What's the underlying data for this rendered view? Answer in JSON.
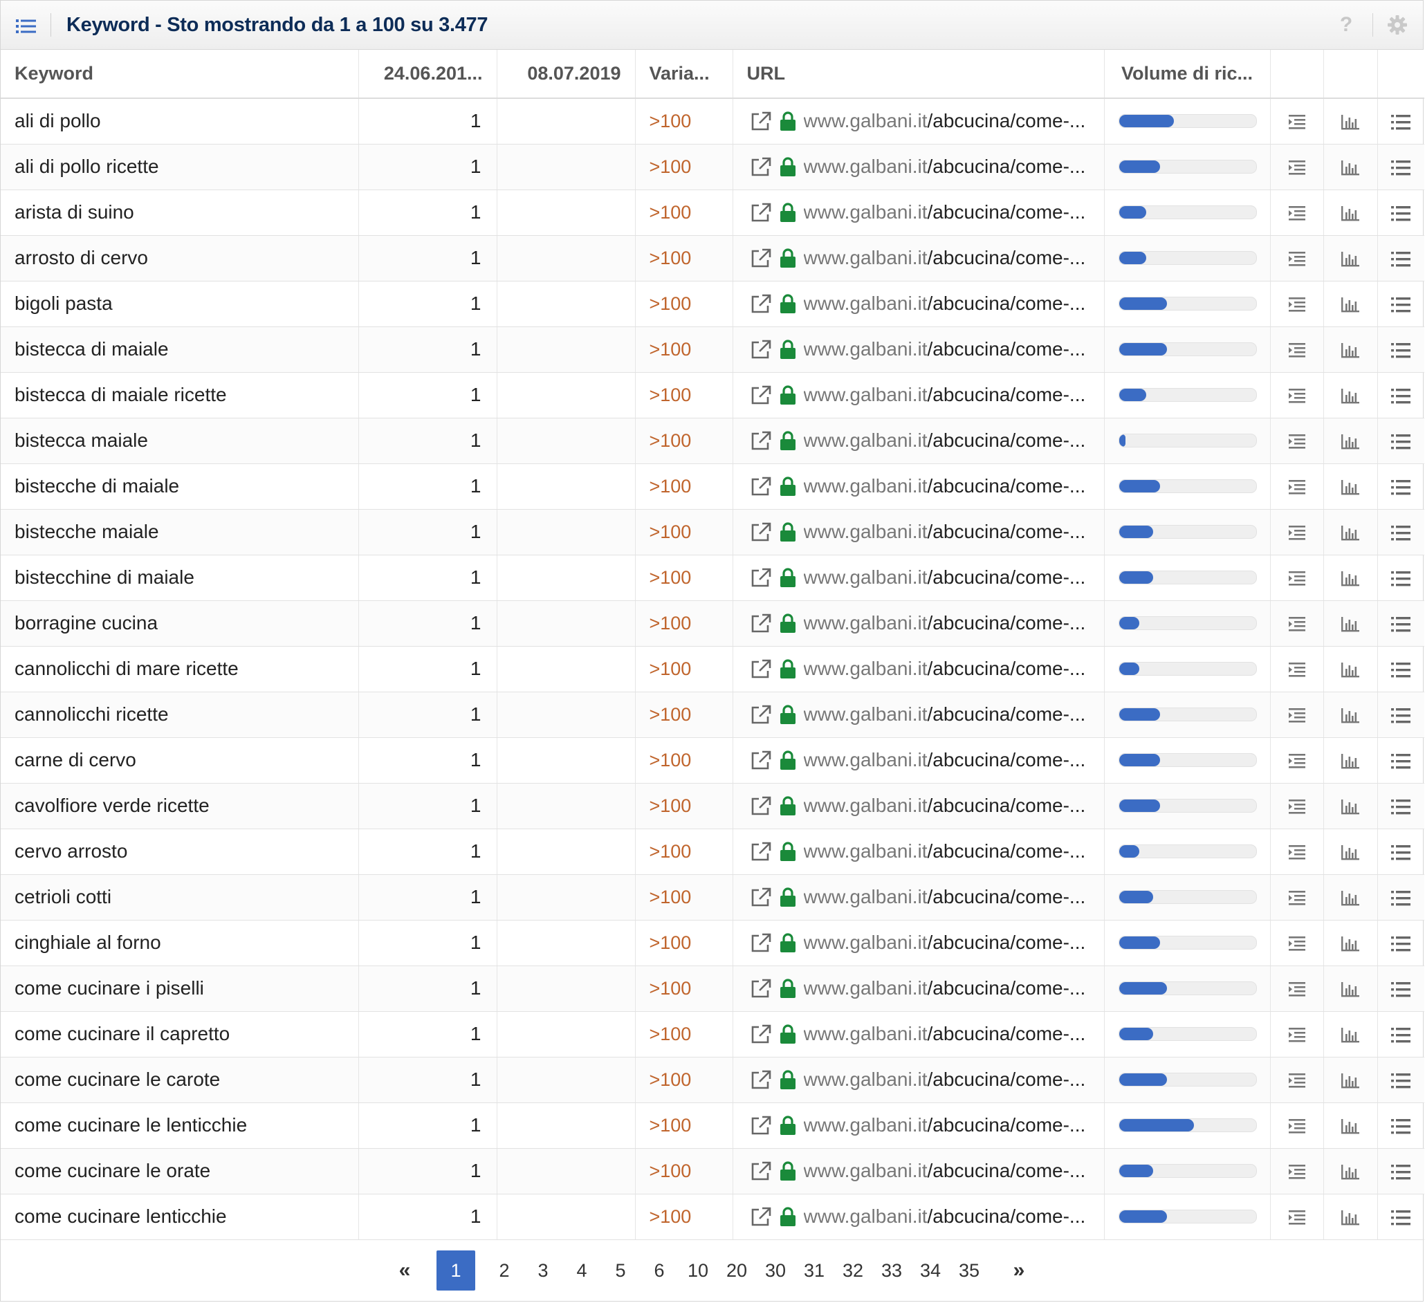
{
  "header": {
    "title": "Keyword - Sto mostrando da 1 a 100 su 3.477",
    "help_label": "?"
  },
  "columns": {
    "keyword": "Keyword",
    "date1": "24.06.201...",
    "date2": "08.07.2019",
    "variation": "Varia...",
    "url": "URL",
    "volume": "Volume di ric..."
  },
  "colors": {
    "accent": "#3b6cc4",
    "title": "#0d2c57",
    "variation": "#c0652d",
    "lock": "#1a8a3a"
  },
  "rows": [
    {
      "keyword": "ali di pollo",
      "pos1": "1",
      "pos2": "",
      "variation": ">100",
      "url_domain": "www.galbani.it",
      "url_path": "/abcucina/come-...",
      "volume": 0.4
    },
    {
      "keyword": "ali di pollo ricette",
      "pos1": "1",
      "pos2": "",
      "variation": ">100",
      "url_domain": "www.galbani.it",
      "url_path": "/abcucina/come-...",
      "volume": 0.3
    },
    {
      "keyword": "arista di suino",
      "pos1": "1",
      "pos2": "",
      "variation": ">100",
      "url_domain": "www.galbani.it",
      "url_path": "/abcucina/come-...",
      "volume": 0.2
    },
    {
      "keyword": "arrosto di cervo",
      "pos1": "1",
      "pos2": "",
      "variation": ">100",
      "url_domain": "www.galbani.it",
      "url_path": "/abcucina/come-...",
      "volume": 0.2
    },
    {
      "keyword": "bigoli pasta",
      "pos1": "1",
      "pos2": "",
      "variation": ">100",
      "url_domain": "www.galbani.it",
      "url_path": "/abcucina/come-...",
      "volume": 0.35
    },
    {
      "keyword": "bistecca di maiale",
      "pos1": "1",
      "pos2": "",
      "variation": ">100",
      "url_domain": "www.galbani.it",
      "url_path": "/abcucina/come-...",
      "volume": 0.35
    },
    {
      "keyword": "bistecca di maiale ricette",
      "pos1": "1",
      "pos2": "",
      "variation": ">100",
      "url_domain": "www.galbani.it",
      "url_path": "/abcucina/come-...",
      "volume": 0.2
    },
    {
      "keyword": "bistecca maiale",
      "pos1": "1",
      "pos2": "",
      "variation": ">100",
      "url_domain": "www.galbani.it",
      "url_path": "/abcucina/come-...",
      "volume": 0.05
    },
    {
      "keyword": "bistecche di maiale",
      "pos1": "1",
      "pos2": "",
      "variation": ">100",
      "url_domain": "www.galbani.it",
      "url_path": "/abcucina/come-...",
      "volume": 0.3
    },
    {
      "keyword": "bistecche maiale",
      "pos1": "1",
      "pos2": "",
      "variation": ">100",
      "url_domain": "www.galbani.it",
      "url_path": "/abcucina/come-...",
      "volume": 0.25
    },
    {
      "keyword": "bistecchine di maiale",
      "pos1": "1",
      "pos2": "",
      "variation": ">100",
      "url_domain": "www.galbani.it",
      "url_path": "/abcucina/come-...",
      "volume": 0.25
    },
    {
      "keyword": "borragine cucina",
      "pos1": "1",
      "pos2": "",
      "variation": ">100",
      "url_domain": "www.galbani.it",
      "url_path": "/abcucina/come-...",
      "volume": 0.15
    },
    {
      "keyword": "cannolicchi di mare ricette",
      "pos1": "1",
      "pos2": "",
      "variation": ">100",
      "url_domain": "www.galbani.it",
      "url_path": "/abcucina/come-...",
      "volume": 0.15
    },
    {
      "keyword": "cannolicchi ricette",
      "pos1": "1",
      "pos2": "",
      "variation": ">100",
      "url_domain": "www.galbani.it",
      "url_path": "/abcucina/come-...",
      "volume": 0.3
    },
    {
      "keyword": "carne di cervo",
      "pos1": "1",
      "pos2": "",
      "variation": ">100",
      "url_domain": "www.galbani.it",
      "url_path": "/abcucina/come-...",
      "volume": 0.3
    },
    {
      "keyword": "cavolfiore verde ricette",
      "pos1": "1",
      "pos2": "",
      "variation": ">100",
      "url_domain": "www.galbani.it",
      "url_path": "/abcucina/come-...",
      "volume": 0.3
    },
    {
      "keyword": "cervo arrosto",
      "pos1": "1",
      "pos2": "",
      "variation": ">100",
      "url_domain": "www.galbani.it",
      "url_path": "/abcucina/come-...",
      "volume": 0.15
    },
    {
      "keyword": "cetrioli cotti",
      "pos1": "1",
      "pos2": "",
      "variation": ">100",
      "url_domain": "www.galbani.it",
      "url_path": "/abcucina/come-...",
      "volume": 0.25
    },
    {
      "keyword": "cinghiale al forno",
      "pos1": "1",
      "pos2": "",
      "variation": ">100",
      "url_domain": "www.galbani.it",
      "url_path": "/abcucina/come-...",
      "volume": 0.3
    },
    {
      "keyword": "come cucinare i piselli",
      "pos1": "1",
      "pos2": "",
      "variation": ">100",
      "url_domain": "www.galbani.it",
      "url_path": "/abcucina/come-...",
      "volume": 0.35
    },
    {
      "keyword": "come cucinare il capretto",
      "pos1": "1",
      "pos2": "",
      "variation": ">100",
      "url_domain": "www.galbani.it",
      "url_path": "/abcucina/come-...",
      "volume": 0.25
    },
    {
      "keyword": "come cucinare le carote",
      "pos1": "1",
      "pos2": "",
      "variation": ">100",
      "url_domain": "www.galbani.it",
      "url_path": "/abcucina/come-...",
      "volume": 0.35
    },
    {
      "keyword": "come cucinare le lenticchie",
      "pos1": "1",
      "pos2": "",
      "variation": ">100",
      "url_domain": "www.galbani.it",
      "url_path": "/abcucina/come-...",
      "volume": 0.55
    },
    {
      "keyword": "come cucinare le orate",
      "pos1": "1",
      "pos2": "",
      "variation": ">100",
      "url_domain": "www.galbani.it",
      "url_path": "/abcucina/come-...",
      "volume": 0.25
    },
    {
      "keyword": "come cucinare lenticchie",
      "pos1": "1",
      "pos2": "",
      "variation": ">100",
      "url_domain": "www.galbani.it",
      "url_path": "/abcucina/come-...",
      "volume": 0.35
    }
  ],
  "row_icons": [
    "external-link-icon",
    "lock-icon",
    "indent-list-icon",
    "bar-chart-icon",
    "list-icon"
  ],
  "pagination": {
    "prev": "«",
    "next": "»",
    "pages": [
      "1",
      "2",
      "3",
      "4",
      "5",
      "6",
      "10",
      "20",
      "30",
      "31",
      "32",
      "33",
      "34",
      "35"
    ],
    "active": "1"
  }
}
